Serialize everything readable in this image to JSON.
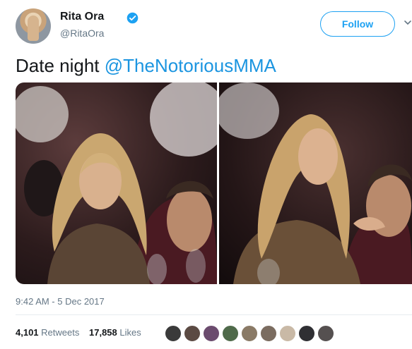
{
  "author": {
    "name": "Rita Ora",
    "handle": "@RitaOra",
    "verified": true
  },
  "follow_button": "Follow",
  "tweet": {
    "text_prefix": "Date night ",
    "mention": "@TheNotoriousMMA"
  },
  "media": {
    "photo_count": 2
  },
  "timestamp": "9:42 AM - 5 Dec 2017",
  "stats": {
    "retweets_count": "4,101",
    "retweets_label": "Retweets",
    "likes_count": "17,858",
    "likes_label": "Likes"
  },
  "likers": {
    "count": 9,
    "colors": [
      "#3a3a3a",
      "#5b4a43",
      "#6b4b6e",
      "#4f6a4a",
      "#8a7a66",
      "#7b6c60",
      "#c9b9a6",
      "#2f2f33",
      "#555050"
    ]
  },
  "colors": {
    "accent": "#1da1f2",
    "mention": "#1b95e0",
    "text": "#14171a",
    "muted": "#657786"
  }
}
